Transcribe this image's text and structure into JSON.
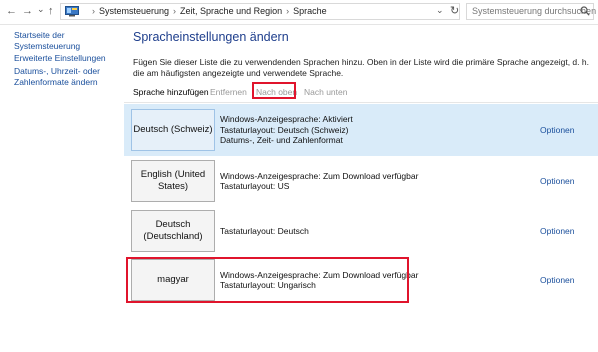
{
  "address_bar": {
    "back": "←",
    "forward": "→",
    "recent": "⌄",
    "up": "↑",
    "breadcrumbs": [
      "Systemsteuerung",
      "Zeit, Sprache und Region",
      "Sprache"
    ],
    "refresh": "↻",
    "search_placeholder": "Systemsteuerung durchsuchen"
  },
  "sidebar": {
    "items": [
      {
        "label": "Startseite der Systemsteuerung"
      },
      {
        "label": "Erweiterte Einstellungen"
      },
      {
        "label": "Datums-, Uhrzeit- oder Zahlenformate ändern"
      }
    ]
  },
  "main": {
    "title": "Spracheinstellungen ändern",
    "description": "Fügen Sie dieser Liste die zu verwendenden Sprachen hinzu. Oben in der Liste wird die primäre Sprache angezeigt, d. h. die am häufigsten angezeigte und verwendete Sprache.",
    "toolbar": {
      "add": "Sprache hinzufügen",
      "remove": "Entfernen",
      "move_up": "Nach oben",
      "move_down": "Nach unten"
    },
    "languages": [
      {
        "name": "Deutsch (Schweiz)",
        "lines": [
          "Windows-Anzeigesprache: Aktiviert",
          "Tastaturlayout: Deutsch (Schweiz)",
          "Datums-, Zeit- und Zahlenformat"
        ],
        "options": "Optionen"
      },
      {
        "name": "English (United States)",
        "lines": [
          "Windows-Anzeigesprache: Zum Download verfügbar",
          "Tastaturlayout: US"
        ],
        "options": "Optionen"
      },
      {
        "name": "Deutsch (Deutschland)",
        "lines": [
          "Tastaturlayout: Deutsch"
        ],
        "options": "Optionen"
      },
      {
        "name": "magyar",
        "lines": [
          "Windows-Anzeigesprache: Zum Download verfügbar",
          "Tastaturlayout: Ungarisch"
        ],
        "options": "Optionen"
      }
    ]
  },
  "colors": {
    "link": "#1a4f9c",
    "title": "#1e3e8c",
    "selected_row": "#d9ebf9",
    "highlight": "#e0142c"
  }
}
